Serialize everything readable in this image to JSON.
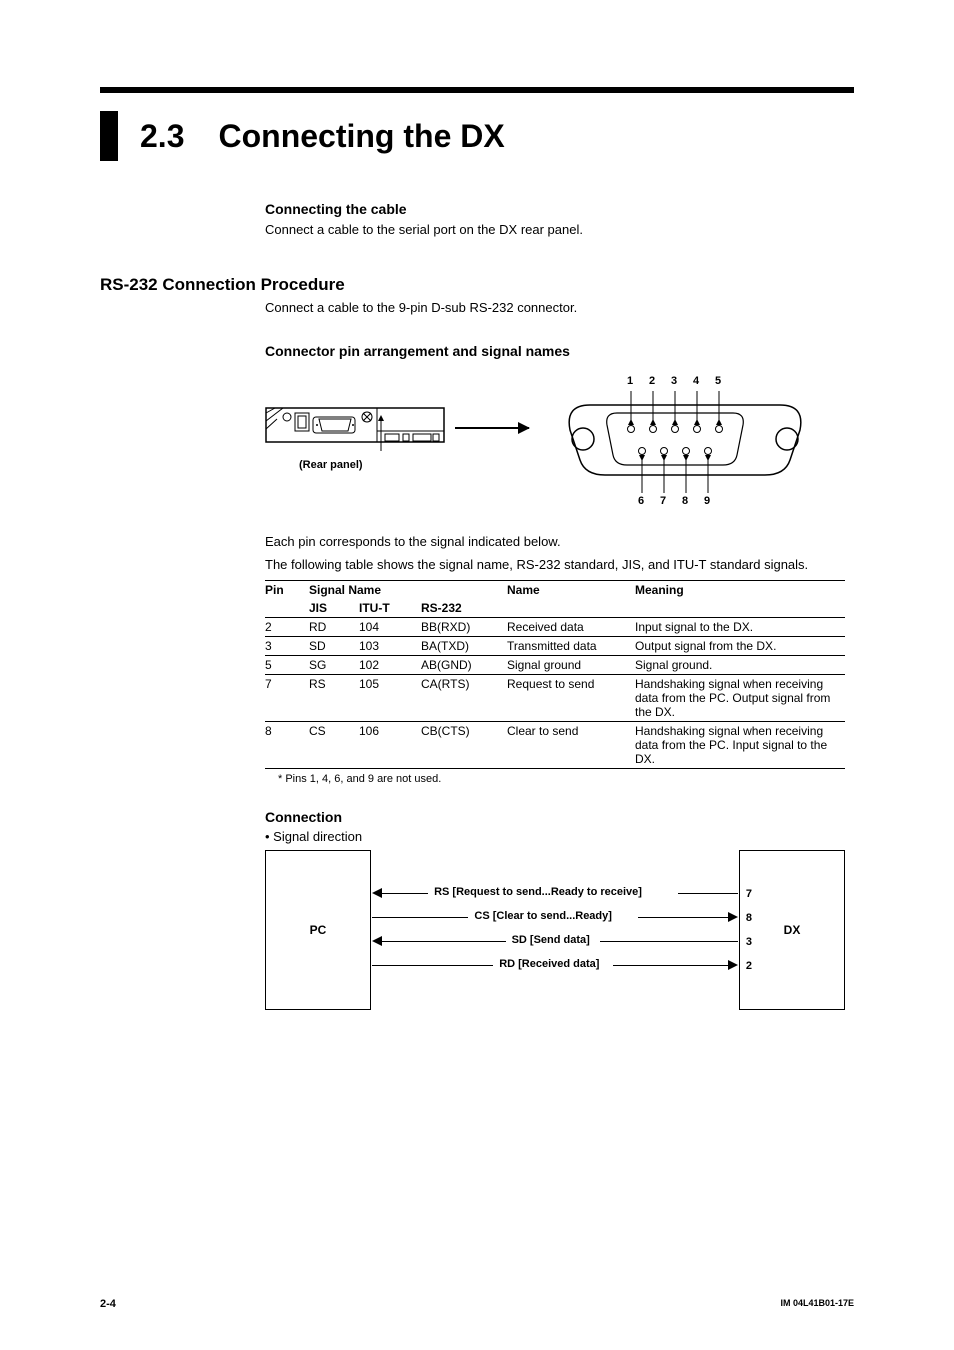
{
  "section": {
    "number": "2.3",
    "title": "Connecting the DX"
  },
  "cable": {
    "heading": "Connecting the cable",
    "text": "Connect a cable to the serial port on the DX rear panel."
  },
  "rs232": {
    "heading": "RS-232 Connection Procedure",
    "text": "Connect a cable to the 9-pin D-sub RS-232 connector.",
    "pinHeading": "Connector pin arrangement and signal names",
    "rearLabel": "(Rear panel)",
    "pinTop": [
      "1",
      "2",
      "3",
      "4",
      "5"
    ],
    "pinBot": [
      "6",
      "7",
      "8",
      "9"
    ],
    "tableIntro1": "Each pin corresponds to the signal indicated below.",
    "tableIntro2": "The following table shows the signal name, RS-232 standard, JIS, and ITU-T standard signals.",
    "headers": {
      "pin": "Pin",
      "sig": "Signal Name",
      "jis": "JIS",
      "itu": "ITU-T",
      "rs": "RS-232",
      "name": "Name",
      "meaning": "Meaning"
    },
    "rows": [
      {
        "pin": "2",
        "jis": "RD",
        "itu": "104",
        "rs": "BB(RXD)",
        "name": "Received data",
        "meaning": "Input signal to the DX."
      },
      {
        "pin": "3",
        "jis": "SD",
        "itu": "103",
        "rs": "BA(TXD)",
        "name": "Transmitted data",
        "meaning": "Output signal from the DX."
      },
      {
        "pin": "5",
        "jis": "SG",
        "itu": "102",
        "rs": "AB(GND)",
        "name": "Signal ground",
        "meaning": "Signal ground."
      },
      {
        "pin": "7",
        "jis": "RS",
        "itu": "105",
        "rs": "CA(RTS)",
        "name": "Request to send",
        "meaning": "Handshaking signal when receiving data from the PC. Output signal from the DX."
      },
      {
        "pin": "8",
        "jis": "CS",
        "itu": "106",
        "rs": "CB(CTS)",
        "name": "Clear to send",
        "meaning": "Handshaking signal when receiving data from the PC. Input signal to the DX."
      }
    ],
    "footnote": "* Pins 1, 4, 6, and 9 are not used."
  },
  "conn": {
    "heading": "Connection",
    "bullet": "•  Signal direction",
    "pc": "PC",
    "dx": "DX",
    "lines": [
      {
        "label": "RS [Request to send...Ready to receive]",
        "pin": "7",
        "dir": "left"
      },
      {
        "label": "CS [Clear to send...Ready]",
        "pin": "8",
        "dir": "right"
      },
      {
        "label": "SD [Send data]",
        "pin": "3",
        "dir": "left"
      },
      {
        "label": "RD [Received data]",
        "pin": "2",
        "dir": "right"
      }
    ]
  },
  "footer": {
    "page": "2-4",
    "doc": "IM 04L41B01-17E"
  }
}
